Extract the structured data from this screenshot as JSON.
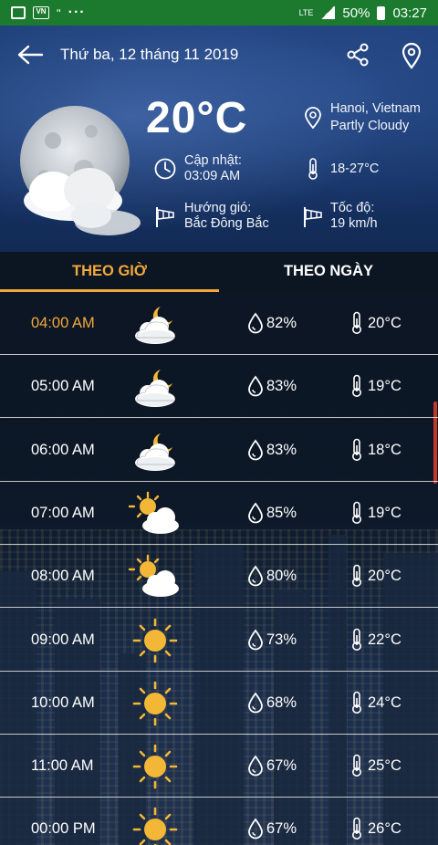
{
  "status_bar": {
    "battery": "50%",
    "time": "03:27",
    "network": "LTE",
    "left_icons": [
      "image-icon",
      "vn-icon",
      "footprints-icon",
      "more-dots-icon"
    ]
  },
  "header": {
    "date": "Thứ ba, 12 tháng 11 2019",
    "temperature": "20°C",
    "location": "Hanoi, Vietnam",
    "condition": "Partly Cloudy",
    "updated_label": "Cập nhật:",
    "updated_value": "03:09 AM",
    "temp_range": "18-27°C",
    "wind_dir_label": "Hướng gió:",
    "wind_dir_value": "Bắc Đông Bắc",
    "wind_speed_label": "Tốc độ:",
    "wind_speed_value": "19 km/h"
  },
  "tabs": [
    {
      "label": "THEO GIỜ",
      "active": true
    },
    {
      "label": "THEO NGÀY",
      "active": false
    }
  ],
  "hourly": [
    {
      "time": "04:00 AM",
      "icon": "moon-cloud-icon",
      "humidity": "82%",
      "temp": "20°C"
    },
    {
      "time": "05:00 AM",
      "icon": "moon-cloud-icon",
      "humidity": "83%",
      "temp": "19°C"
    },
    {
      "time": "06:00 AM",
      "icon": "moon-cloud-icon",
      "humidity": "83%",
      "temp": "18°C"
    },
    {
      "time": "07:00 AM",
      "icon": "sun-cloud-icon",
      "humidity": "85%",
      "temp": "19°C"
    },
    {
      "time": "08:00 AM",
      "icon": "sun-cloud-icon",
      "humidity": "80%",
      "temp": "20°C"
    },
    {
      "time": "09:00 AM",
      "icon": "sun-icon",
      "humidity": "73%",
      "temp": "22°C"
    },
    {
      "time": "10:00 AM",
      "icon": "sun-icon",
      "humidity": "68%",
      "temp": "24°C"
    },
    {
      "time": "11:00 AM",
      "icon": "sun-icon",
      "humidity": "67%",
      "temp": "25°C"
    },
    {
      "time": "00:00 PM",
      "icon": "sun-icon",
      "humidity": "67%",
      "temp": "26°C"
    }
  ],
  "colors": {
    "status_bar": "#1b7a2e",
    "accent": "#f2a93b",
    "header_bg": "#1c3e78",
    "list_bg": "#0c1624"
  }
}
